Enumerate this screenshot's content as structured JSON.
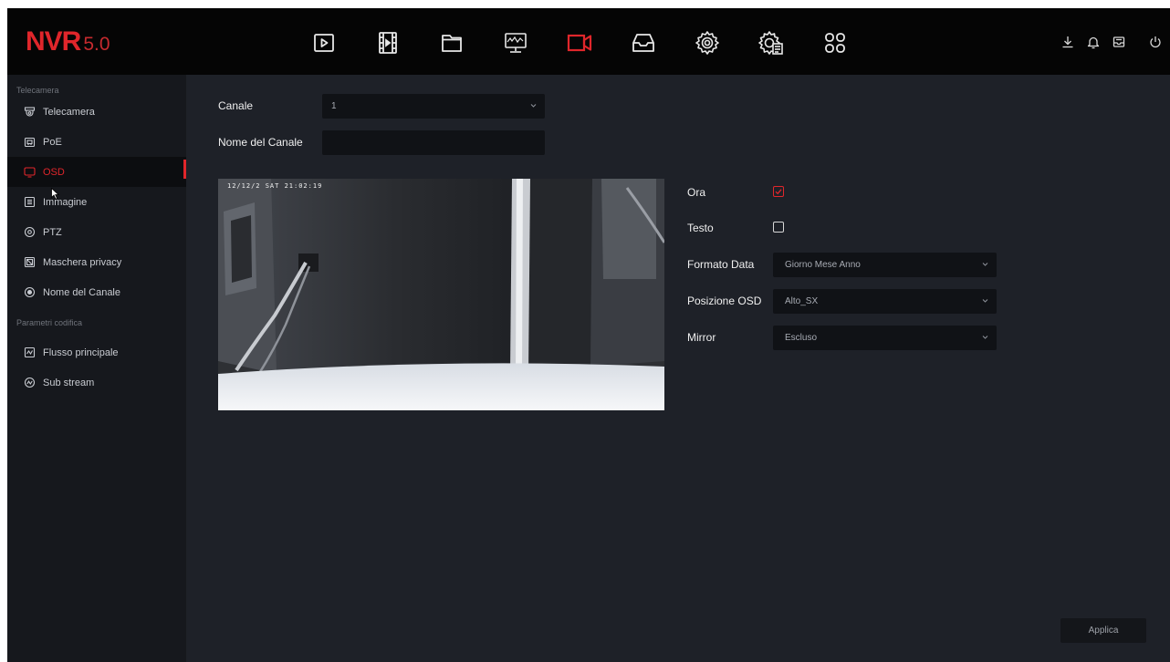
{
  "app": {
    "logo": "NVR",
    "version": "5.0"
  },
  "topnav": [
    {
      "icon": "playback-icon",
      "active": false
    },
    {
      "icon": "video-clip-icon",
      "active": false
    },
    {
      "icon": "file-folder-icon",
      "active": false
    },
    {
      "icon": "monitor-icon",
      "active": false
    },
    {
      "icon": "camera-icon",
      "active": true
    },
    {
      "icon": "storage-icon",
      "active": false
    },
    {
      "icon": "settings-gear-icon",
      "active": false
    },
    {
      "icon": "system-settings-icon",
      "active": false
    },
    {
      "icon": "grid-apps-icon",
      "active": false
    }
  ],
  "topright": [
    {
      "icon": "download-icon"
    },
    {
      "icon": "bell-icon"
    },
    {
      "icon": "inbox-icon"
    },
    {
      "icon": "power-icon"
    }
  ],
  "sidebar": {
    "section1": "Telecamera",
    "items1": [
      {
        "label": "Telecamera",
        "icon": "camera-icon",
        "active": false
      },
      {
        "label": "PoE",
        "icon": "poe-icon",
        "active": false
      },
      {
        "label": "OSD",
        "icon": "osd-monitor-icon",
        "active": true
      },
      {
        "label": "Immagine",
        "icon": "image-icon",
        "active": false
      },
      {
        "label": "PTZ",
        "icon": "ptz-icon",
        "active": false
      },
      {
        "label": "Maschera privacy",
        "icon": "privacy-mask-icon",
        "active": false
      },
      {
        "label": "Nome del Canale",
        "icon": "channel-name-icon",
        "active": false
      }
    ],
    "section2": "Parametri codifica",
    "items2": [
      {
        "label": "Flusso principale",
        "icon": "main-stream-icon",
        "active": false
      },
      {
        "label": "Sub stream",
        "icon": "sub-stream-icon",
        "active": false
      }
    ]
  },
  "form": {
    "channel_label": "Canale",
    "channel_value": "1",
    "channel_name_label": "Nome del Canale",
    "channel_name_value": "",
    "ora_label": "Ora",
    "ora_checked": true,
    "testo_label": "Testo",
    "testo_checked": false,
    "date_format_label": "Formato Data",
    "date_format_value": "Giorno Mese Anno",
    "osd_position_label": "Posizione OSD",
    "osd_position_value": "Alto_SX",
    "mirror_label": "Mirror",
    "mirror_value": "Escluso"
  },
  "preview": {
    "osd_text": "12/12/2  SAT 21:02:19"
  },
  "apply_label": "Applica",
  "colors": {
    "accent": "#e0262b",
    "background": "#1e2128",
    "sidebar": "#16181d",
    "topbar": "#050505"
  }
}
